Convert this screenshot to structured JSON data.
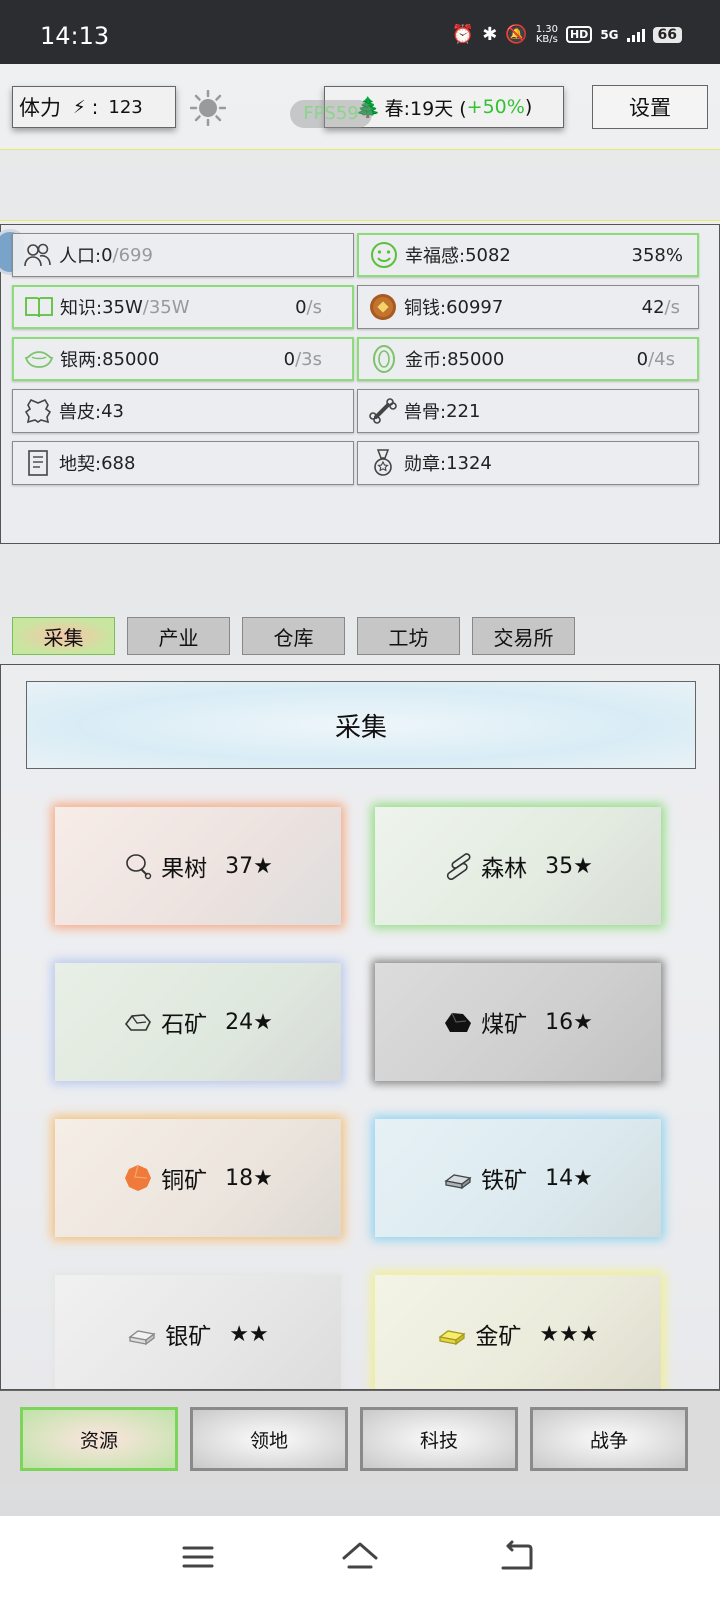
{
  "status_bar": {
    "time": "14:13",
    "net_speed_value": "1.30",
    "net_speed_unit": "KB/s",
    "hd": "HD",
    "network": "5G",
    "battery": "66"
  },
  "header": {
    "stamina_label": "体力",
    "stamina_sep": ":",
    "stamina_value": "123",
    "fps": "FPS59",
    "season_text": "春:19天 (",
    "season_pct": "+50%",
    "season_close": ")",
    "settings_label": "设置"
  },
  "resources": {
    "population": {
      "label": "人口:",
      "value": "0",
      "max": "/699"
    },
    "happiness": {
      "label": "幸福感:",
      "value": "5082",
      "pct": "358%"
    },
    "knowledge": {
      "label": "知识:",
      "value": "35W",
      "max": "/35W",
      "rate": "0",
      "rate_unit": "/s"
    },
    "copper_coin": {
      "label": "铜钱:",
      "value": "60997",
      "rate": "42",
      "rate_unit": "/s"
    },
    "silver": {
      "label": "银两:",
      "value": "85000",
      "rate": "0",
      "rate_unit": "/3s"
    },
    "gold_coin": {
      "label": "金币:",
      "value": "85000",
      "rate": "0",
      "rate_unit": "/4s"
    },
    "hide": {
      "label": "兽皮:",
      "value": "43"
    },
    "bone": {
      "label": "兽骨:",
      "value": "221"
    },
    "deed": {
      "label": "地契:",
      "value": "688"
    },
    "medal": {
      "label": "勋章:",
      "value": "1324"
    }
  },
  "tabs": [
    "采集",
    "产业",
    "仓库",
    "工坊",
    "交易所"
  ],
  "active_tab": "采集",
  "banner_title": "采集",
  "gather_cards": [
    {
      "name": "果树",
      "stars": "37★",
      "icon": "meat-icon",
      "glow": "#f7a980"
    },
    {
      "name": "森林",
      "stars": "35★",
      "icon": "log-icon",
      "glow": "#92dd82"
    },
    {
      "name": "石矿",
      "stars": "24★",
      "icon": "stone-icon",
      "glow": "#b8c8ef"
    },
    {
      "name": "煤矿",
      "stars": "16★",
      "icon": "coal-icon",
      "glow": "#8a8a8a"
    },
    {
      "name": "铜矿",
      "stars": "18★",
      "icon": "copper-ore-icon",
      "glow": "#f6c07a"
    },
    {
      "name": "铁矿",
      "stars": "14★",
      "icon": "iron-ingot-icon",
      "glow": "#8fd3f0"
    },
    {
      "name": "银矿",
      "stars": "★★",
      "icon": "silver-ingot-icon",
      "glow": "#e4e4e4"
    },
    {
      "name": "金矿",
      "stars": "★★★",
      "icon": "gold-ingot-icon",
      "glow": "#f2f08a"
    }
  ],
  "bottom_nav": [
    "资源",
    "领地",
    "科技",
    "战争"
  ],
  "active_nav": "资源",
  "colors": {
    "accent_green": "#35c135",
    "active_border": "#7dd45a"
  }
}
